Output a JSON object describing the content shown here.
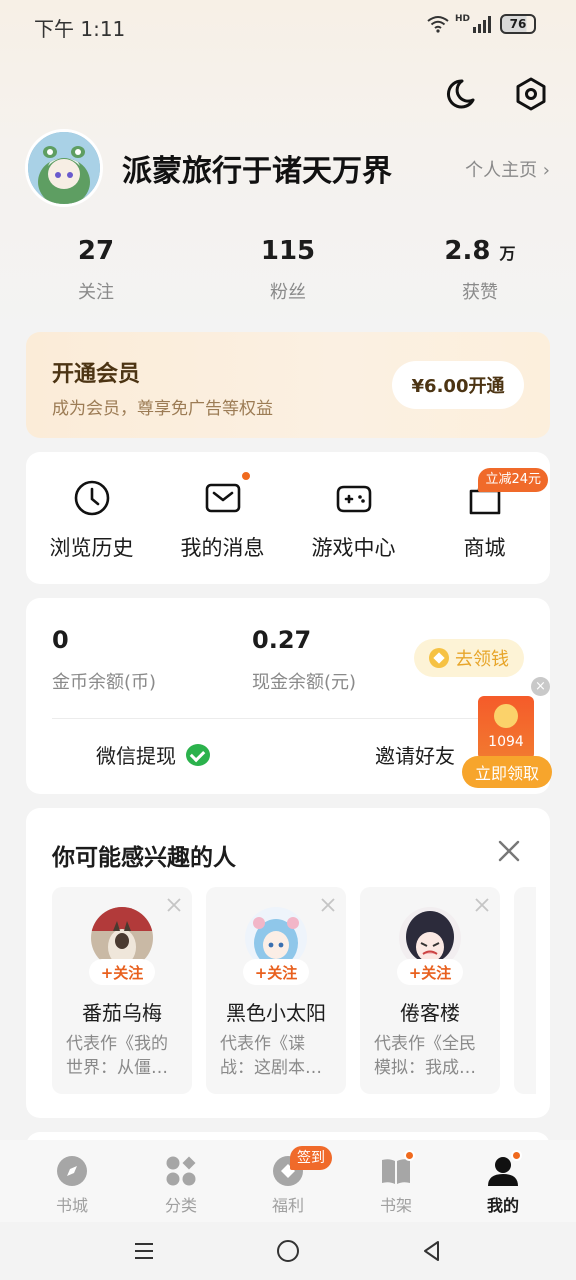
{
  "status_bar": {
    "time": "下午 1:11",
    "network": "HD",
    "battery": "76"
  },
  "header_icons": [
    "moon-icon",
    "settings-icon"
  ],
  "profile": {
    "name": "派蒙旅行于诸天万界",
    "homepage_link": "个人主页 ›"
  },
  "stats": [
    {
      "value": "27",
      "unit": "",
      "label": "关注"
    },
    {
      "value": "115",
      "unit": "",
      "label": "粉丝"
    },
    {
      "value": "2.8",
      "unit": "万",
      "label": "获赞"
    }
  ],
  "vip": {
    "title": "开通会员",
    "subtitle": "成为会员，尊享免广告等权益",
    "button": "¥6.00开通"
  },
  "quick_actions": [
    {
      "label": "浏览历史",
      "icon": "clock-icon"
    },
    {
      "label": "我的消息",
      "icon": "mail-icon"
    },
    {
      "label": "游戏中心",
      "icon": "gamepad-icon"
    },
    {
      "label": "商城",
      "icon": "shop-bag-icon",
      "badge": "立减24元"
    }
  ],
  "wallet": {
    "coins_value": "0",
    "coins_label": "金币余额(币)",
    "cash_value": "0.27",
    "cash_label": "现金余额(元)",
    "earn_button": "去领钱",
    "withdraw_label": "微信提现",
    "invite_label": "邀请好友"
  },
  "red_packet": {
    "amount": "1094",
    "button": "立即领取",
    "close": "×"
  },
  "recommend": {
    "title": "你可能感兴趣的人",
    "follow_label": "+关注",
    "people": [
      {
        "name": "番茄乌梅",
        "desc_line1": "代表作《我的",
        "desc_line2": "世界：从僵…"
      },
      {
        "name": "黑色小太阳",
        "desc_line1": "代表作《谍",
        "desc_line2": "战：这剧本…"
      },
      {
        "name": "倦客楼",
        "desc_line1": "代表作《全民",
        "desc_line2": "模拟：我成…"
      }
    ]
  },
  "tabs": [
    {
      "label": "书城",
      "icon": "compass-icon"
    },
    {
      "label": "分类",
      "icon": "grid-icon"
    },
    {
      "label": "福利",
      "icon": "coin-icon",
      "badge": "签到"
    },
    {
      "label": "书架",
      "icon": "book-icon"
    },
    {
      "label": "我的",
      "icon": "person-icon",
      "active": true
    }
  ],
  "colors": {
    "accent": "#f06a2a",
    "vip_text": "#4c3413",
    "wechat_green": "#2bb24c"
  }
}
